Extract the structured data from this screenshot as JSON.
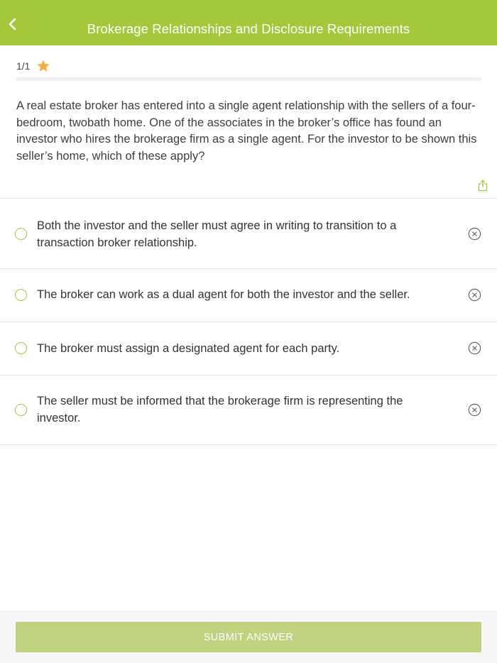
{
  "header": {
    "title": "Brokerage Relationships and Disclosure Requirements",
    "back_icon": "chevron-left-icon"
  },
  "progress": {
    "counter": "1/1",
    "star_icon": "star-icon",
    "star_color": "#f5b041",
    "fraction": 0
  },
  "question": {
    "text": "A real estate broker has entered into a single agent relationship with the sellers of a four-bedroom, twobath home. One of the associates in the broker’s office has found an investor who hires the brokerage firm as a single agent. For the investor to be shown this seller’s home, which of these apply?",
    "share_icon": "share-icon"
  },
  "options": [
    {
      "text": "Both the investor and the seller must agree in writing to transition to a transaction broker relationship."
    },
    {
      "text": "The broker can work as a dual agent for both the investor and the seller."
    },
    {
      "text": "The broker must assign a designated agent for each party."
    },
    {
      "text": "The seller must be informed that the brokerage firm is representing the investor."
    }
  ],
  "footer": {
    "submit_label": "SUBMIT ANSWER"
  },
  "colors": {
    "accent": "#a4c73c",
    "submit_disabled": "#bfd27f"
  }
}
